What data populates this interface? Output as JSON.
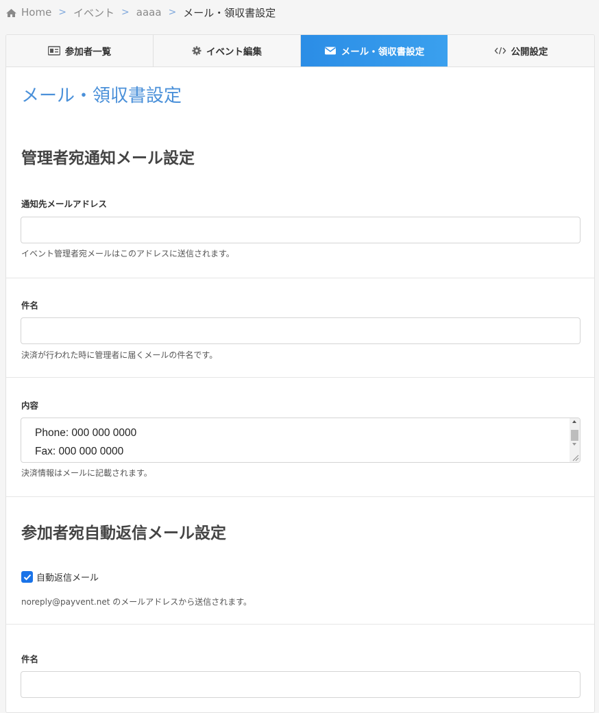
{
  "breadcrumb": {
    "items": [
      "Home",
      "イベント",
      "aaaa"
    ],
    "current": "メール・領収書設定"
  },
  "tabs": [
    {
      "label": "参加者一覧",
      "icon": "id-card-icon",
      "active": false
    },
    {
      "label": "イベント編集",
      "icon": "gear-icon",
      "active": false
    },
    {
      "label": "メール・領収書設定",
      "icon": "envelope-icon",
      "active": true
    },
    {
      "label": "公開設定",
      "icon": "code-icon",
      "active": false
    }
  ],
  "page_title": "メール・領収書設定",
  "admin_section": {
    "title": "管理者宛通知メール設定",
    "notify_label": "通知先メールアドレス",
    "notify_value": "",
    "notify_help": "イベント管理者宛メールはこのアドレスに送信されます。",
    "subject_label": "件名",
    "subject_value": "",
    "subject_help": "決済が行われた時に管理者に届くメールの件名です。",
    "body_label": "内容",
    "body_lines": [
      "Phone: 000 000 0000",
      "Fax: 000 000 0000"
    ],
    "body_help": "決済情報はメールに記載されます。"
  },
  "participant_section": {
    "title": "参加者宛自動返信メール設定",
    "autoreply_label": "自動返信メール",
    "autoreply_checked": true,
    "autoreply_help": "noreply@payvent.net のメールアドレスから送信されます。",
    "subject_label": "件名",
    "subject_value": ""
  },
  "colors": {
    "accent": "#2b8de6",
    "title": "#4a90d9",
    "checkbox": "#1a73e8"
  }
}
